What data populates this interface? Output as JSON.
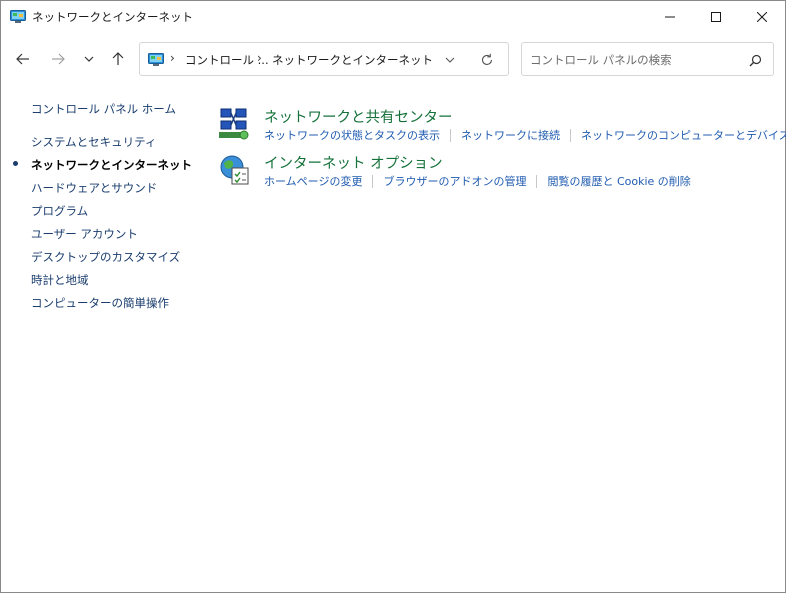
{
  "window": {
    "title": "ネットワークとインターネット"
  },
  "address": {
    "crumbs": [
      "コントロール ...",
      "ネットワークとインターネット"
    ]
  },
  "search": {
    "placeholder": "コントロール パネルの検索"
  },
  "sidebar": {
    "items": [
      {
        "label": "コントロール パネル ホーム",
        "current": false
      },
      {
        "label": "システムとセキュリティ",
        "current": false
      },
      {
        "label": "ネットワークとインターネット",
        "current": true
      },
      {
        "label": "ハードウェアとサウンド",
        "current": false
      },
      {
        "label": "プログラム",
        "current": false
      },
      {
        "label": "ユーザー アカウント",
        "current": false
      },
      {
        "label": "デスクトップのカスタマイズ",
        "current": false
      },
      {
        "label": "時計と地域",
        "current": false
      },
      {
        "label": "コンピューターの簡単操作",
        "current": false
      }
    ]
  },
  "categories": [
    {
      "title": "ネットワークと共有センター",
      "icon": "network-sharing-center-icon",
      "links": [
        "ネットワークの状態とタスクの表示",
        "ネットワークに接続",
        "ネットワークのコンピューターとデバイスの表示"
      ]
    },
    {
      "title": "インターネット オプション",
      "icon": "internet-options-icon",
      "links": [
        "ホームページの変更",
        "ブラウザーのアドオンの管理",
        "閲覧の履歴と Cookie の削除"
      ]
    }
  ],
  "colors": {
    "category_title": "#15713a",
    "link": "#1f5bb0",
    "sidebar_link": "#1a3d6e"
  }
}
